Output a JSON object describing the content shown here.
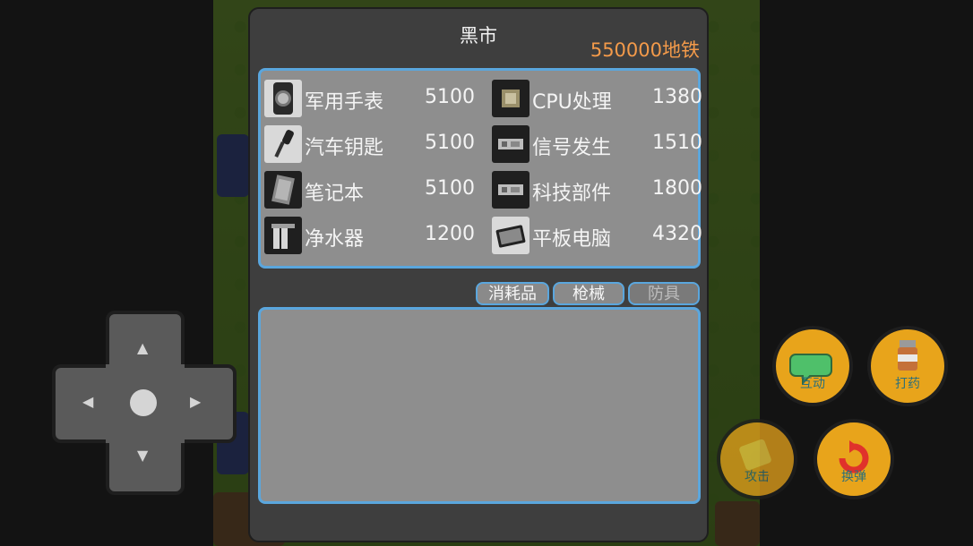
{
  "panel": {
    "title": "黑市",
    "currency": "550000地铁"
  },
  "items": [
    {
      "name": "军用手表",
      "price": "5100",
      "icon": "watch-icon"
    },
    {
      "name": "CPU处理",
      "price": "1380",
      "icon": "cpu-chip-icon"
    },
    {
      "name": "汽车钥匙",
      "price": "5100",
      "icon": "car-key-icon"
    },
    {
      "name": "信号发生",
      "price": "1510",
      "icon": "circuit-board-icon"
    },
    {
      "name": "笔记本",
      "price": "5100",
      "icon": "notebook-icon"
    },
    {
      "name": "科技部件",
      "price": "1800",
      "icon": "circuit-board-icon"
    },
    {
      "name": "净水器",
      "price": "1200",
      "icon": "water-filter-icon"
    },
    {
      "name": "平板电脑",
      "price": "4320",
      "icon": "tablet-icon"
    }
  ],
  "tabs": [
    {
      "label": "消耗品",
      "state": "normal"
    },
    {
      "label": "枪械",
      "state": "normal"
    },
    {
      "label": "防具",
      "state": "disabled"
    }
  ],
  "actions": [
    {
      "label": "互动",
      "icon": "speech-bubble-icon"
    },
    {
      "label": "打药",
      "icon": "medicine-bottle-icon"
    },
    {
      "label": "攻击",
      "icon": "attack-icon"
    },
    {
      "label": "换弹",
      "icon": "reload-icon"
    }
  ],
  "colors": {
    "currency": "#f39a4a",
    "frame": "#5aa6dd",
    "action_button": "#e8a41b"
  }
}
